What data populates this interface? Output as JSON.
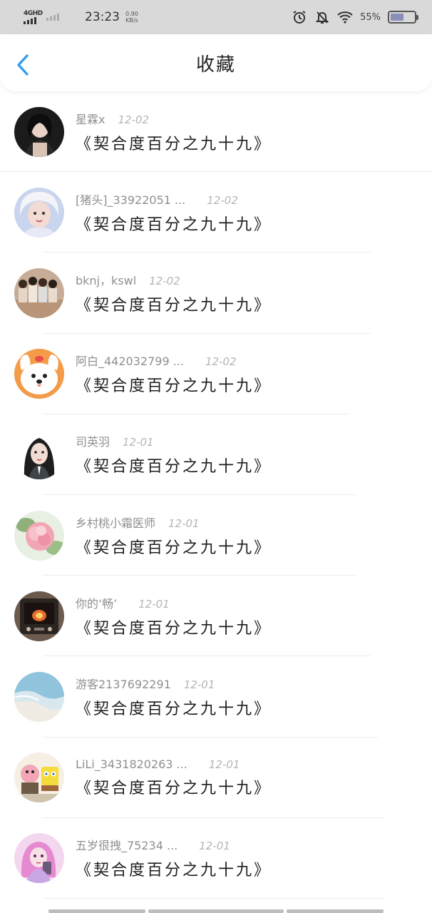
{
  "status_bar": {
    "network": "4GHD",
    "time": "23:23",
    "speed_value": "0.90",
    "speed_unit": "KB/s",
    "battery_percent": "55%",
    "battery_level": 0.55
  },
  "header": {
    "title": "收藏"
  },
  "items": [
    {
      "name": "星霖x",
      "date": "12-02",
      "title": "《契合度百分之九十九》"
    },
    {
      "name": "[猪头]_33922051 ...",
      "date": "12-02",
      "title": "《契合度百分之九十九》"
    },
    {
      "name": "bknj，kswl",
      "date": "12-02",
      "title": "《契合度百分之九十九》"
    },
    {
      "name": "阿白_442032799 ...",
      "date": "12-02",
      "title": "《契合度百分之九十九》"
    },
    {
      "name": "司英羽",
      "date": "12-01",
      "title": "《契合度百分之九十九》"
    },
    {
      "name": "乡村桃小霜医师",
      "date": "12-01",
      "title": "《契合度百分之九十九》"
    },
    {
      "name": "你的‘畅’",
      "date": "12-01",
      "title": "《契合度百分之九十九》"
    },
    {
      "name": "游客2137692291",
      "date": "12-01",
      "title": "《契合度百分之九十九》"
    },
    {
      "name": "LiLi_3431820263 ...",
      "date": "12-01",
      "title": "《契合度百分之九十九》"
    },
    {
      "name": "五岁很拽_75234 ...",
      "date": "12-01",
      "title": "《契合度百分之九十九》"
    }
  ]
}
